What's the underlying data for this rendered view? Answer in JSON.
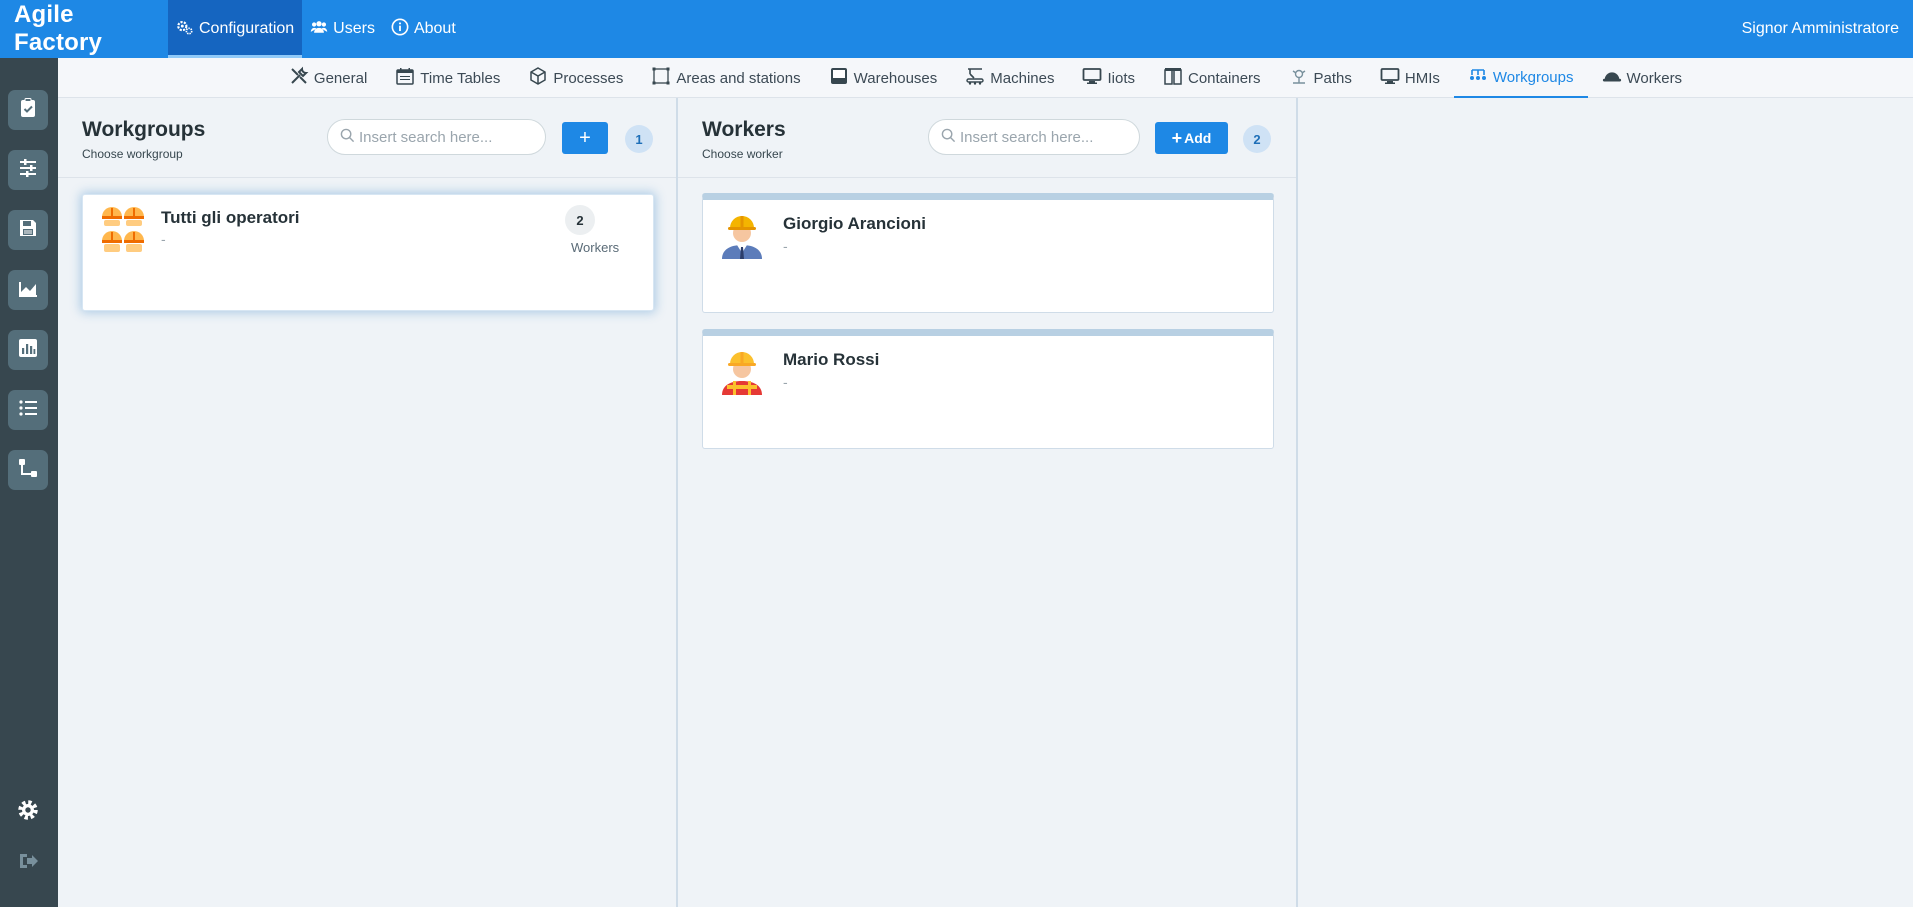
{
  "app": {
    "title": "Agile Factory",
    "user": "Signor Amministratore"
  },
  "topnav": [
    {
      "label": "Configuration",
      "icon": "gears-icon",
      "active": true
    },
    {
      "label": "Users",
      "icon": "users-icon",
      "active": false
    },
    {
      "label": "About",
      "icon": "info-icon",
      "active": false
    }
  ],
  "sidebar": [
    {
      "icon": "clipboard-check-icon"
    },
    {
      "icon": "sliders-icon"
    },
    {
      "icon": "save-icon"
    },
    {
      "icon": "factory-icon"
    },
    {
      "icon": "bar-chart-icon"
    },
    {
      "icon": "list-icon"
    },
    {
      "icon": "flow-icon"
    },
    {
      "icon": "gear-icon"
    },
    {
      "icon": "logout-icon"
    }
  ],
  "subtabs": [
    {
      "label": "General",
      "icon": "tools-icon",
      "active": false
    },
    {
      "label": "Time Tables",
      "icon": "calendar-icon",
      "active": false
    },
    {
      "label": "Processes",
      "icon": "cube-icon",
      "active": false
    },
    {
      "label": "Areas and stations",
      "icon": "area-icon",
      "active": false
    },
    {
      "label": "Warehouses",
      "icon": "inbox-icon",
      "active": false
    },
    {
      "label": "Machines",
      "icon": "crane-icon",
      "active": false
    },
    {
      "label": "Iiots",
      "icon": "monitor-icon",
      "active": false
    },
    {
      "label": "Containers",
      "icon": "container-icon",
      "active": false
    },
    {
      "label": "Paths",
      "icon": "robot-icon",
      "active": false
    },
    {
      "label": "HMIs",
      "icon": "monitor-icon",
      "active": false
    },
    {
      "label": "Workgroups",
      "icon": "workgroup-icon",
      "active": true
    },
    {
      "label": "Workers",
      "icon": "helmet-icon",
      "active": false
    }
  ],
  "workgroups_panel": {
    "title": "Workgroups",
    "subtitle": "Choose workgroup",
    "search_placeholder": "Insert search here...",
    "add_label": "+",
    "count": "1",
    "items": [
      {
        "name": "Tutti gli operatori",
        "description": "-",
        "workers_count": "2",
        "workers_label": "Workers"
      }
    ]
  },
  "workers_panel": {
    "title": "Workers",
    "subtitle": "Choose worker",
    "search_placeholder": "Insert search here...",
    "add_label": "Add",
    "count": "2",
    "items": [
      {
        "name": "Giorgio Arancioni",
        "description": "-"
      },
      {
        "name": "Mario Rossi",
        "description": "-"
      }
    ]
  },
  "colors": {
    "primary": "#1e88e5",
    "sidebar": "#37474f",
    "background": "#eff3f7"
  }
}
